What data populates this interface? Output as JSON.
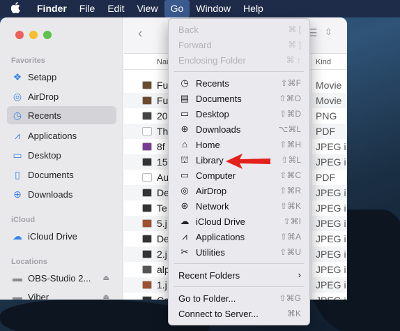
{
  "menubar": {
    "app": "Finder",
    "items": [
      "File",
      "Edit",
      "View",
      "Go",
      "Window",
      "Help"
    ]
  },
  "sidebar": {
    "favorites_header": "Favorites",
    "favorites": [
      {
        "label": "Setapp",
        "icon": "setapp-icon"
      },
      {
        "label": "AirDrop",
        "icon": "airdrop-icon"
      },
      {
        "label": "Recents",
        "icon": "clock-icon"
      },
      {
        "label": "Applications",
        "icon": "applications-icon"
      },
      {
        "label": "Desktop",
        "icon": "desktop-icon"
      },
      {
        "label": "Documents",
        "icon": "document-icon"
      },
      {
        "label": "Downloads",
        "icon": "download-icon"
      }
    ],
    "icloud_header": "iCloud",
    "icloud": [
      {
        "label": "iCloud Drive",
        "icon": "cloud-icon"
      }
    ],
    "locations_header": "Locations",
    "locations": [
      {
        "label": "OBS-Studio 2...",
        "icon": "disk-icon"
      },
      {
        "label": "Viber",
        "icon": "disk-icon"
      }
    ]
  },
  "files": {
    "name_header": "Nai",
    "kind_header": "Kind",
    "rows": [
      {
        "name": "Fu",
        "kind": "Movie"
      },
      {
        "name": "Fu",
        "kind": "Movie"
      },
      {
        "name": "20",
        "kind": "PNG in"
      },
      {
        "name": "Th",
        "kind": "PDF"
      },
      {
        "name": "8f",
        "kind": "JPEG i"
      },
      {
        "name": "15",
        "kind": "JPEG i"
      },
      {
        "name": "Au",
        "kind": "PDF"
      },
      {
        "name": "De",
        "kind": "JPEG i"
      },
      {
        "name": "Te",
        "kind": "JPEG i"
      },
      {
        "name": "5.j",
        "kind": "JPEG i"
      },
      {
        "name": "De",
        "kind": "JPEG i"
      },
      {
        "name": "2.j",
        "kind": "JPEG i"
      },
      {
        "name": "alp",
        "kind": "JPEG i"
      },
      {
        "name": "1.j",
        "kind": "JPEG i"
      },
      {
        "name": "Co",
        "kind": "JPEG i"
      }
    ]
  },
  "go_menu": {
    "top": [
      {
        "label": "Back",
        "shortcut": "⌘ [",
        "disabled": true
      },
      {
        "label": "Forward",
        "shortcut": "⌘ ]",
        "disabled": true
      },
      {
        "label": "Enclosing Folder",
        "shortcut": "⌘ ↑",
        "disabled": true
      }
    ],
    "places": [
      {
        "label": "Recents",
        "shortcut": "⇧⌘F",
        "icon": "clock-icon"
      },
      {
        "label": "Documents",
        "shortcut": "⇧⌘O",
        "icon": "document-icon"
      },
      {
        "label": "Desktop",
        "shortcut": "⇧⌘D",
        "icon": "desktop-icon"
      },
      {
        "label": "Downloads",
        "shortcut": "⌥⌘L",
        "icon": "download-icon"
      },
      {
        "label": "Home",
        "shortcut": "⇧⌘H",
        "icon": "home-icon"
      },
      {
        "label": "Library",
        "shortcut": "⇧⌘L",
        "icon": "library-icon"
      },
      {
        "label": "Computer",
        "shortcut": "⇧⌘C",
        "icon": "computer-icon"
      },
      {
        "label": "AirDrop",
        "shortcut": "⇧⌘R",
        "icon": "airdrop-icon"
      },
      {
        "label": "Network",
        "shortcut": "⇧⌘K",
        "icon": "globe-icon"
      },
      {
        "label": "iCloud Drive",
        "shortcut": "⇧⌘I",
        "icon": "cloud-icon"
      },
      {
        "label": "Applications",
        "shortcut": "⇧⌘A",
        "icon": "applications-icon"
      },
      {
        "label": "Utilities",
        "shortcut": "⇧⌘U",
        "icon": "utilities-icon"
      }
    ],
    "recent_folders": "Recent Folders",
    "bottom": [
      {
        "label": "Go to Folder...",
        "shortcut": "⇧⌘G"
      },
      {
        "label": "Connect to Server...",
        "shortcut": "⌘K"
      }
    ]
  },
  "colors": {
    "menubar": "#1e2c4a",
    "menu_highlight": "#3b5a8e",
    "accent": "#3a84e8",
    "arrow": "#e3201b"
  }
}
